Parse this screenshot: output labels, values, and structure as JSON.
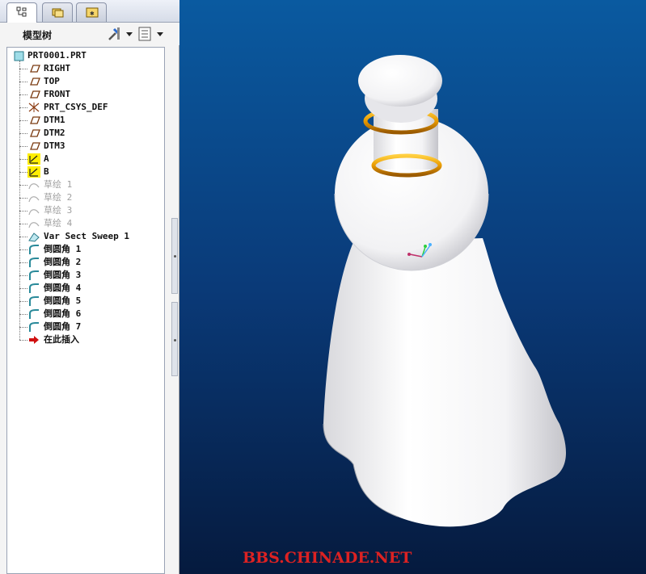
{
  "tabs": [
    {
      "name": "model-tree-tab",
      "icon": "tree-icon",
      "active": true
    },
    {
      "name": "folder-tab",
      "icon": "folder-icon",
      "active": false
    },
    {
      "name": "favorites-tab",
      "icon": "star-icon",
      "active": false
    }
  ],
  "panel": {
    "title": "模型树",
    "settings_icon": "tools-icon",
    "show_icon": "list-icon"
  },
  "tree": {
    "root": "PRT0001.PRT",
    "items": [
      {
        "label": "RIGHT",
        "icon": "datum-plane-icon",
        "dim": false
      },
      {
        "label": "TOP",
        "icon": "datum-plane-icon",
        "dim": false
      },
      {
        "label": "FRONT",
        "icon": "datum-plane-icon",
        "dim": false
      },
      {
        "label": "PRT_CSYS_DEF",
        "icon": "csys-icon",
        "dim": false
      },
      {
        "label": "DTM1",
        "icon": "datum-plane-icon",
        "dim": false
      },
      {
        "label": "DTM2",
        "icon": "datum-plane-icon",
        "dim": false
      },
      {
        "label": "DTM3",
        "icon": "datum-plane-icon",
        "dim": false
      },
      {
        "label": "A",
        "icon": "datum-axis-icon",
        "dim": false
      },
      {
        "label": "B",
        "icon": "datum-axis-icon",
        "dim": false
      },
      {
        "label": "草绘 1",
        "icon": "sketch-icon",
        "dim": true
      },
      {
        "label": "草绘 2",
        "icon": "sketch-icon",
        "dim": true
      },
      {
        "label": "草绘 3",
        "icon": "sketch-icon",
        "dim": true
      },
      {
        "label": "草绘 4",
        "icon": "sketch-icon",
        "dim": true
      },
      {
        "label": "Var Sect Sweep 1",
        "icon": "sweep-icon",
        "dim": false
      },
      {
        "label": "倒圆角 1",
        "icon": "round-icon",
        "dim": false
      },
      {
        "label": "倒圆角 2",
        "icon": "round-icon",
        "dim": false
      },
      {
        "label": "倒圆角 3",
        "icon": "round-icon",
        "dim": false
      },
      {
        "label": "倒圆角 4",
        "icon": "round-icon",
        "dim": false
      },
      {
        "label": "倒圆角 5",
        "icon": "round-icon",
        "dim": false
      },
      {
        "label": "倒圆角 6",
        "icon": "round-icon",
        "dim": false
      },
      {
        "label": "倒圆角 7",
        "icon": "round-icon",
        "dim": false
      },
      {
        "label": "在此插入",
        "icon": "insert-arrow-icon",
        "dim": false
      }
    ]
  },
  "viewport": {
    "background_top": "#0a5aa0",
    "background_bottom": "#051a3e",
    "model_color": "#ffffff",
    "ring_color": "#e89a00",
    "watermark": "BBS.CHINADE.NET"
  }
}
